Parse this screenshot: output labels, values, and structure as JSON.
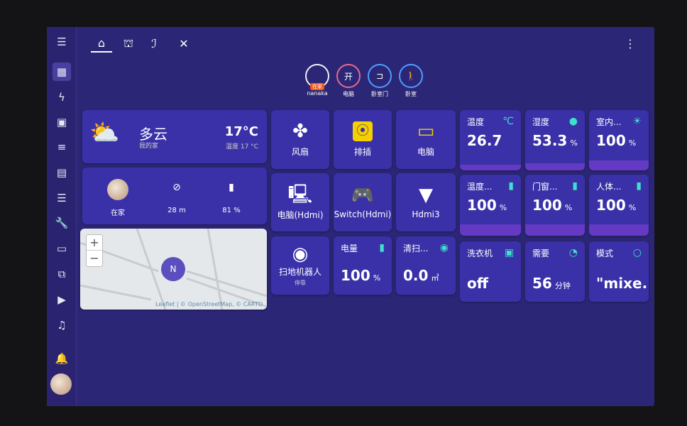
{
  "sidebar": {
    "items": [
      "menu-icon",
      "dashboard-icon",
      "energy-icon",
      "badge-icon",
      "list-icon",
      "chart-icon",
      "layers-icon",
      "wrench-icon",
      "server-icon",
      "network-icon",
      "media-icon",
      "music-icon",
      "bell-icon",
      "avatar"
    ]
  },
  "tabs": [
    "home-icon",
    "robot-icon",
    "seat-icon",
    "tools-icon"
  ],
  "badges": [
    {
      "label": "nanaka",
      "tag": "在家"
    },
    {
      "label": "电脑",
      "text": "开"
    },
    {
      "label": "卧室门",
      "icon": "door-icon"
    },
    {
      "label": "卧室",
      "icon": "walk-icon"
    }
  ],
  "weather": {
    "condition": "多云",
    "location": "我的家",
    "temp": "17°C",
    "detail": "温度 17 °C"
  },
  "person": {
    "state": "在家",
    "distance": "28 m",
    "battery": "81 %"
  },
  "map": {
    "zoom_in": "+",
    "zoom_out": "−",
    "marker": "N",
    "attribution": "Leaflet | © OpenStreetMap, © CARTO"
  },
  "tiles": [
    {
      "name": "风扇",
      "icon": "fan-icon"
    },
    {
      "name": "排插",
      "icon": "socket-icon"
    },
    {
      "name": "电脑",
      "icon": "laptop-icon"
    },
    {
      "name": "电脑(Hdmi)",
      "icon": "desktop-icon"
    },
    {
      "name": "Switch(Hdmi)",
      "icon": "gamepad-icon"
    },
    {
      "name": "Hdmi3",
      "icon": "hdmi-icon"
    },
    {
      "name": "扫地机器人",
      "state": "停靠",
      "icon": "vacuum-icon"
    }
  ],
  "small_sensors": [
    {
      "name": "电量",
      "value": "100",
      "unit": "%"
    },
    {
      "name": "清扫...",
      "value": "0.0",
      "unit": "㎡"
    }
  ],
  "sensors": [
    {
      "name": "温度",
      "value": "26.7",
      "unit": "",
      "icon": "℃"
    },
    {
      "name": "湿度",
      "value": "53.3",
      "unit": "%",
      "icon": "💧"
    },
    {
      "name": "室内...",
      "value": "100",
      "unit": "%",
      "icon": "☀"
    },
    {
      "name": "温度...",
      "value": "100",
      "unit": "%",
      "icon": "▮"
    },
    {
      "name": "门窗...",
      "value": "100",
      "unit": "%",
      "icon": "▮"
    },
    {
      "name": "人体...",
      "value": "100",
      "unit": "%",
      "icon": "▮"
    },
    {
      "name": "洗衣机",
      "value": "off",
      "unit": "",
      "icon": "▣"
    },
    {
      "name": "需要",
      "value": "56",
      "unit": "分钟",
      "icon": "◔"
    },
    {
      "name": "模式",
      "value": "\"mixe...",
      "unit": "",
      "icon": "○"
    }
  ],
  "colors": {
    "background": "#2c2676",
    "card": "#3a31a8",
    "accent": "#3de0c8",
    "graph": "#6c3bc8"
  }
}
